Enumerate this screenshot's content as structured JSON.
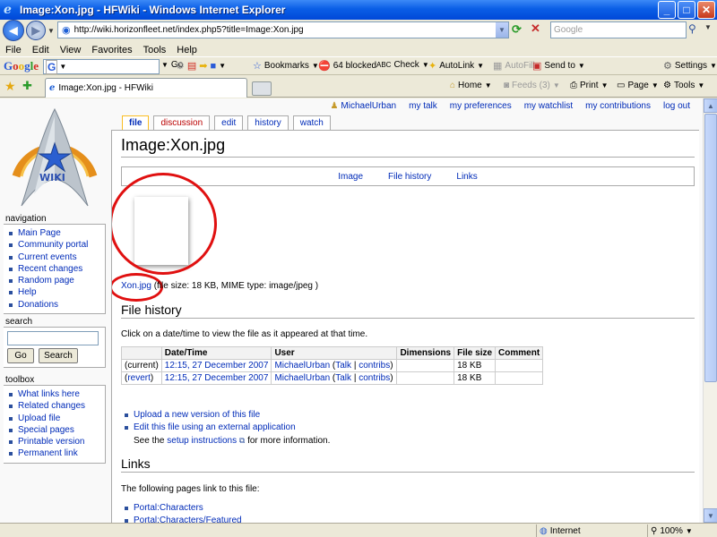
{
  "window": {
    "title": "Image:Xon.jpg - HFWiki - Windows Internet Explorer"
  },
  "address": {
    "url": "http://wiki.horizonfleet.net/index.php5?title=Image:Xon.jpg",
    "search_placeholder": "Google"
  },
  "menu": [
    "File",
    "Edit",
    "View",
    "Favorites",
    "Tools",
    "Help"
  ],
  "google_toolbar": {
    "go": "Go",
    "bookmarks": "Bookmarks",
    "blocked": "64 blocked",
    "check": "Check",
    "autolink": "AutoLink",
    "autofill": "AutoFill",
    "send_to": "Send to",
    "settings": "Settings"
  },
  "tab": {
    "title": "Image:Xon.jpg - HFWiki"
  },
  "commands": {
    "home": "Home",
    "feeds": "Feeds (3)",
    "print": "Print",
    "page": "Page",
    "tools": "Tools"
  },
  "personal_tools": [
    "MichaelUrban",
    "my talk",
    "my preferences",
    "my watchlist",
    "my contributions",
    "log out"
  ],
  "content_tabs": [
    {
      "label": "file",
      "selected": true
    },
    {
      "label": "discussion",
      "new": true
    },
    {
      "label": "edit"
    },
    {
      "label": "history"
    },
    {
      "label": "watch"
    }
  ],
  "heading": "Image:Xon.jpg",
  "filetoc": [
    "Image",
    "File history",
    "Links"
  ],
  "file_info": {
    "link": "Xon.jpg",
    "details": "(file size: 18 KB, MIME type: image/jpeg )"
  },
  "file_history": {
    "heading": "File history",
    "intro": "Click on a date/time to view the file as it appeared at that time.",
    "columns": [
      "",
      "Date/Time",
      "User",
      "Dimensions",
      "File size",
      "Comment"
    ],
    "rows": [
      {
        "which": "(current)",
        "date": "12:15, 27 December 2007",
        "user": "MichaelUrban",
        "talk": "Talk",
        "contribs": "contribs",
        "dimensions": "",
        "size": "18 KB",
        "comment": ""
      },
      {
        "which": "(revert)",
        "date": "12:15, 27 December 2007",
        "user": "MichaelUrban",
        "talk": "Talk",
        "contribs": "contribs",
        "dimensions": "",
        "size": "18 KB",
        "comment": ""
      }
    ],
    "upload_new": "Upload a new version of this file",
    "edit_external": "Edit this file using an external application",
    "see_the": "See the",
    "setup_instructions": "setup instructions",
    "more_info": "for more information."
  },
  "links": {
    "heading": "Links",
    "intro": "The following pages link to this file:",
    "items": [
      "Portal:Characters",
      "Portal:Characters/Featured"
    ]
  },
  "sidebar": {
    "logo_text": "WIKI",
    "navigation": {
      "title": "navigation",
      "items": [
        "Main Page",
        "Community portal",
        "Current events",
        "Recent changes",
        "Random page",
        "Help",
        "Donations"
      ]
    },
    "search": {
      "title": "search",
      "go": "Go",
      "search": "Search"
    },
    "toolbox": {
      "title": "toolbox",
      "items": [
        "What links here",
        "Related changes",
        "Upload file",
        "Special pages",
        "Printable version",
        "Permanent link"
      ]
    }
  },
  "status": {
    "zone": "Internet",
    "zoom": "100%"
  },
  "colors": {
    "annotation_red": "#e01010",
    "link": "#002bb8",
    "new_link": "#ba0000"
  }
}
